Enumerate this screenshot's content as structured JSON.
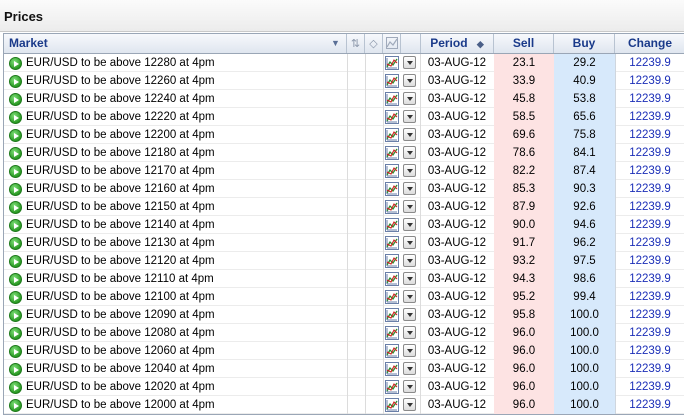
{
  "panel": {
    "title": "Prices"
  },
  "columns": {
    "market": "Market",
    "period": "Period",
    "sell": "Sell",
    "buy": "Buy",
    "change": "Change"
  },
  "colors": {
    "sell_bg": "#fde3e3",
    "buy_bg": "#d7e9fb",
    "change_text": "#1c2fb8",
    "header_text": "#1a3a8a"
  },
  "rows": [
    {
      "market": "EUR/USD to be above 12280 at 4pm",
      "period": "03-AUG-12",
      "sell": "23.1",
      "buy": "29.2",
      "change": "12239.9"
    },
    {
      "market": "EUR/USD to be above 12260 at 4pm",
      "period": "03-AUG-12",
      "sell": "33.9",
      "buy": "40.9",
      "change": "12239.9"
    },
    {
      "market": "EUR/USD to be above 12240 at 4pm",
      "period": "03-AUG-12",
      "sell": "45.8",
      "buy": "53.8",
      "change": "12239.9"
    },
    {
      "market": "EUR/USD to be above 12220 at 4pm",
      "period": "03-AUG-12",
      "sell": "58.5",
      "buy": "65.6",
      "change": "12239.9"
    },
    {
      "market": "EUR/USD to be above 12200 at 4pm",
      "period": "03-AUG-12",
      "sell": "69.6",
      "buy": "75.8",
      "change": "12239.9"
    },
    {
      "market": "EUR/USD to be above 12180 at 4pm",
      "period": "03-AUG-12",
      "sell": "78.6",
      "buy": "84.1",
      "change": "12239.9"
    },
    {
      "market": "EUR/USD to be above 12170 at 4pm",
      "period": "03-AUG-12",
      "sell": "82.2",
      "buy": "87.4",
      "change": "12239.9"
    },
    {
      "market": "EUR/USD to be above 12160 at 4pm",
      "period": "03-AUG-12",
      "sell": "85.3",
      "buy": "90.3",
      "change": "12239.9"
    },
    {
      "market": "EUR/USD to be above 12150 at 4pm",
      "period": "03-AUG-12",
      "sell": "87.9",
      "buy": "92.6",
      "change": "12239.9"
    },
    {
      "market": "EUR/USD to be above 12140 at 4pm",
      "period": "03-AUG-12",
      "sell": "90.0",
      "buy": "94.6",
      "change": "12239.9"
    },
    {
      "market": "EUR/USD to be above 12130 at 4pm",
      "period": "03-AUG-12",
      "sell": "91.7",
      "buy": "96.2",
      "change": "12239.9"
    },
    {
      "market": "EUR/USD to be above 12120 at 4pm",
      "period": "03-AUG-12",
      "sell": "93.2",
      "buy": "97.5",
      "change": "12239.9"
    },
    {
      "market": "EUR/USD to be above 12110 at 4pm",
      "period": "03-AUG-12",
      "sell": "94.3",
      "buy": "98.6",
      "change": "12239.9"
    },
    {
      "market": "EUR/USD to be above 12100 at 4pm",
      "period": "03-AUG-12",
      "sell": "95.2",
      "buy": "99.4",
      "change": "12239.9"
    },
    {
      "market": "EUR/USD to be above 12090 at 4pm",
      "period": "03-AUG-12",
      "sell": "95.8",
      "buy": "100.0",
      "change": "12239.9"
    },
    {
      "market": "EUR/USD to be above 12080 at 4pm",
      "period": "03-AUG-12",
      "sell": "96.0",
      "buy": "100.0",
      "change": "12239.9"
    },
    {
      "market": "EUR/USD to be above 12060 at 4pm",
      "period": "03-AUG-12",
      "sell": "96.0",
      "buy": "100.0",
      "change": "12239.9"
    },
    {
      "market": "EUR/USD to be above 12040 at 4pm",
      "period": "03-AUG-12",
      "sell": "96.0",
      "buy": "100.0",
      "change": "12239.9"
    },
    {
      "market": "EUR/USD to be above 12020 at 4pm",
      "period": "03-AUG-12",
      "sell": "96.0",
      "buy": "100.0",
      "change": "12239.9"
    },
    {
      "market": "EUR/USD to be above 12000 at 4pm",
      "period": "03-AUG-12",
      "sell": "96.0",
      "buy": "100.0",
      "change": "12239.9"
    }
  ]
}
